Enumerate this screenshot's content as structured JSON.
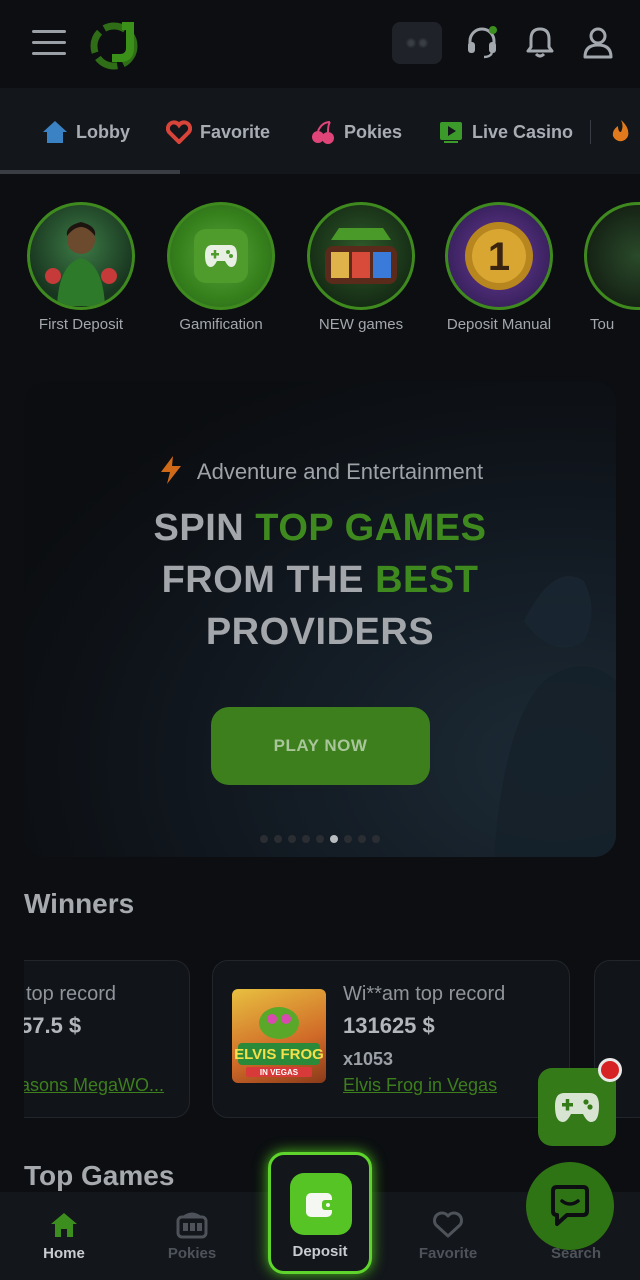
{
  "header": {
    "menu_icon": "hamburger-icon",
    "logo_icon": "j-logo-icon",
    "support_icon": "headset-icon",
    "notifications_icon": "bell-icon",
    "profile_icon": "user-icon"
  },
  "categories": [
    {
      "label": "Lobby",
      "icon": "home-icon",
      "color": "#3b82c4"
    },
    {
      "label": "Favorite",
      "icon": "heart-icon",
      "color": "#d9443a"
    },
    {
      "label": "Pokies",
      "icon": "cherry-icon",
      "color": "#e0457a"
    },
    {
      "label": "Live Casino",
      "icon": "play-icon",
      "color": "#3c9a2a"
    }
  ],
  "stories": [
    {
      "label": "First Deposit"
    },
    {
      "label": "Gamification"
    },
    {
      "label": "NEW games"
    },
    {
      "label": "Deposit Manual"
    },
    {
      "label": "Tou"
    }
  ],
  "banner": {
    "subtitle": "Adventure and Entertainment",
    "line1_a": "SPIN ",
    "line1_b": "TOP GAMES",
    "line2_a": "FROM THE ",
    "line2_b": "BEST",
    "line3": "PROVIDERS",
    "cta": "PLAY NOW",
    "active_slide": 6,
    "total_slides": 9
  },
  "winners": {
    "title": "Winners",
    "cards": [
      {
        "player": "top record",
        "amount": "57.5 $",
        "game": "asons MegaWO..."
      },
      {
        "player": "Wi**am top record",
        "amount": "131625 $",
        "multiplier": "x1053",
        "game": "Elvis Frog in Vegas",
        "thumb_text": "ELVIS FROG",
        "thumb_sub": "IN VEGAS"
      }
    ]
  },
  "top_games": {
    "title": "Top Games"
  },
  "tabbar": {
    "home": "Home",
    "pokies": "Pokies",
    "deposit": "Deposit",
    "favorite": "Favorite",
    "search": "Search"
  },
  "colors": {
    "accent": "#56c425",
    "accent_dark": "#3c7f1c",
    "background": "#0c0e11"
  }
}
